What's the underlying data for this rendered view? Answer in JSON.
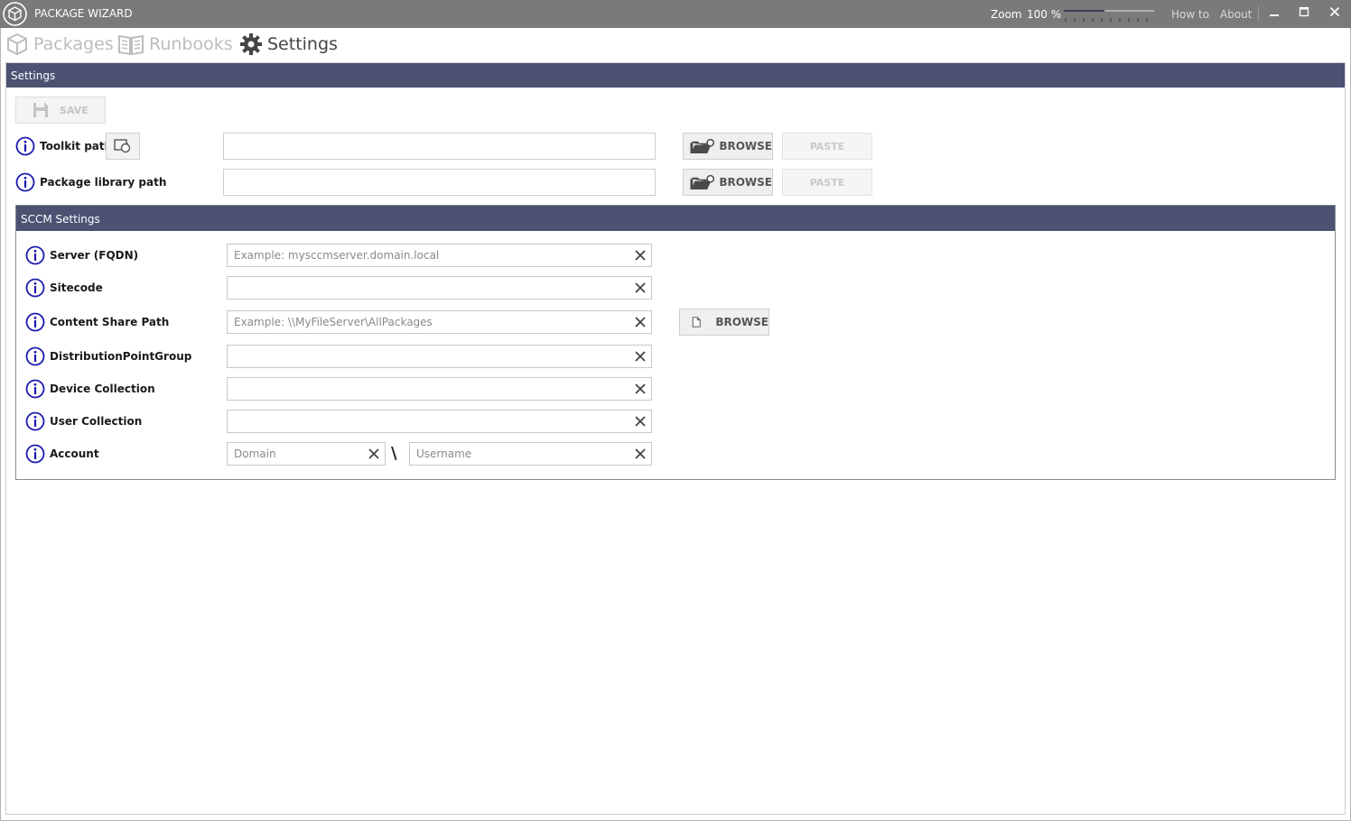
{
  "window": {
    "title": "PACKAGE WIZARD",
    "zoom_label": "Zoom",
    "zoom_value": "100 %",
    "zoom_level_fraction": 0.45,
    "how_to": "How to",
    "about": "About",
    "minimize": "▁",
    "maximize": "☐",
    "close": "✕"
  },
  "nav": {
    "packages": "Packages",
    "runbooks": "Runbooks",
    "settings": "Settings",
    "active": "settings"
  },
  "settings": {
    "header": "Settings",
    "save_label": "SAVE",
    "toolkit_path": {
      "label": "Toolkit path",
      "value": "",
      "browse_label": "BROWSE",
      "paste_label": "PASTE"
    },
    "package_library_path": {
      "label": "Package library path",
      "value": "",
      "browse_label": "BROWSE",
      "paste_label": "PASTE"
    }
  },
  "sccm": {
    "header": "SCCM Settings",
    "server": {
      "label": "Server (FQDN)",
      "placeholder": "Example: mysccmserver.domain.local",
      "value": ""
    },
    "sitecode": {
      "label": "Sitecode",
      "placeholder": "",
      "value": ""
    },
    "content_share_path": {
      "label": "Content Share Path",
      "placeholder": "Example: \\\\MyFileServer\\AllPackages",
      "value": "",
      "browse_label": "BROWSE"
    },
    "distribution_point_group": {
      "label": "DistributionPointGroup",
      "placeholder": "",
      "value": ""
    },
    "device_collection": {
      "label": "Device Collection",
      "placeholder": "",
      "value": ""
    },
    "user_collection": {
      "label": "User Collection",
      "placeholder": "",
      "value": ""
    },
    "account": {
      "label": "Account",
      "domain_placeholder": "Domain",
      "separator": "\\",
      "username_placeholder": "Username"
    }
  },
  "colors": {
    "titlebar": "#7a7a7a",
    "header": "#4b5272",
    "info_icon": "#1a1ab0"
  }
}
